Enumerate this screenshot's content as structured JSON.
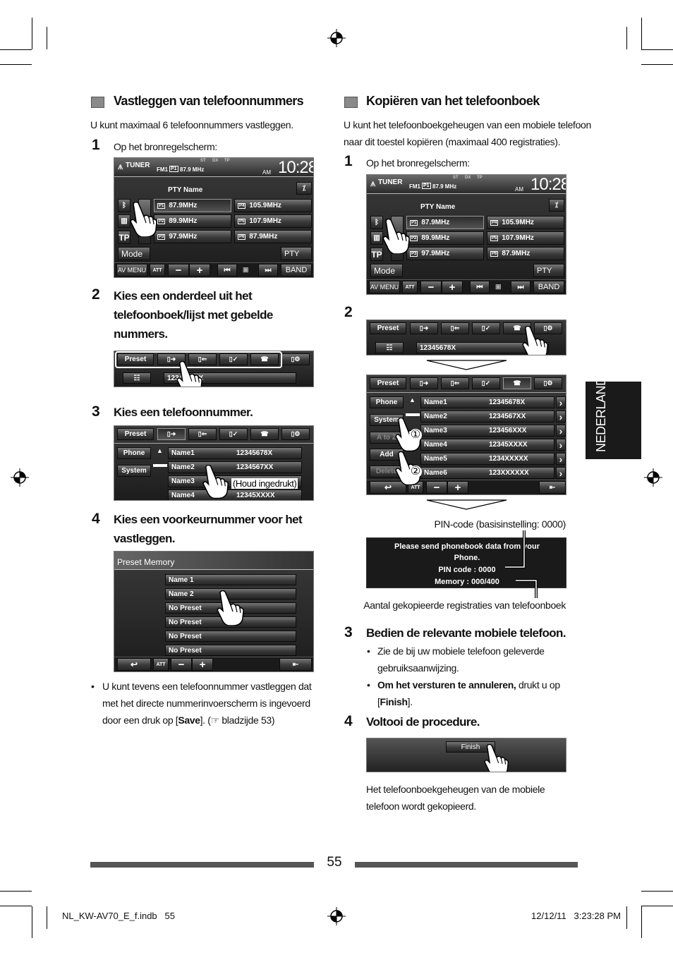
{
  "left": {
    "heading": "Vastleggen van telefoonnummers",
    "intro": "U kunt maximaal 6 telefoonnummers vastleggen.",
    "steps": [
      {
        "num": "1",
        "text": "Op het bronregelscherm:"
      },
      {
        "num": "2",
        "lines": [
          "Kies een onderdeel uit het",
          "telefoonboek/lijst met gebelde",
          "nummers."
        ]
      },
      {
        "num": "3",
        "text": "Kies een telefoonnummer."
      },
      {
        "num": "4",
        "lines": [
          "Kies een voorkeurnummer voor het",
          "vastleggen."
        ]
      }
    ],
    "note": {
      "bullet": "•",
      "line1": "U kunt tevens een telefoonnummer vastleggen dat",
      "line2": "met het directe nummerinvoerscherm is ingevoerd",
      "line3a": "door een druk op [",
      "save": "Save",
      "line3b": "]. (",
      "ref_icon": "☞",
      "line3c": " bladzijde 53)"
    },
    "hold_callout": "(Houd ingedrukt)"
  },
  "right": {
    "heading": "Kopiëren van het telefoonboek",
    "intro": [
      "U kunt het telefoonboekgeheugen van een mobiele telefoon",
      "naar dit toestel kopiëren (maximaal 400 registraties)."
    ],
    "steps": [
      {
        "num": "1",
        "text": "Op het bronregelscherm:"
      },
      {
        "num": "2"
      },
      {
        "num": "3",
        "text": "Bedien de relevante mobiele telefoon."
      },
      {
        "num": "4",
        "text": "Voltooi de procedure."
      }
    ],
    "bullets": [
      {
        "lines": [
          "Zie de bij uw mobiele telefoon geleverde",
          "gebruiksaanwijzing."
        ]
      },
      {
        "bold": "Om het versturen te annuleren,",
        "rest": " drukt u op",
        "l2a": "[",
        "finish": "Finish",
        "l2b": "]."
      }
    ],
    "pin_label": "PIN-code (basisinstelling: 0000)",
    "memory_label": "Aantal gekopieerde registraties van telefoonboek",
    "final": [
      "Het telefoonboekgeheugen van de mobiele",
      "telefoon wordt gekopieerd."
    ],
    "callouts": [
      "①",
      "②"
    ]
  },
  "screens": {
    "tuner": {
      "source": "TUNER",
      "band_info": "FM1",
      "preset_badge": "P1",
      "freq": "87.9 MHz",
      "indicators": [
        "ST",
        "DX",
        "TP"
      ],
      "ampm": "AM",
      "clock": "10:28",
      "pty_name": "PTY Name",
      "presets": [
        {
          "badge": "P1",
          "freq": "87.9MHz"
        },
        {
          "badge": "P2",
          "freq": "89.9MHz"
        },
        {
          "badge": "P3",
          "freq": "97.9MHz"
        },
        {
          "badge": "P4",
          "freq": "105.9MHz"
        },
        {
          "badge": "P5",
          "freq": "107.9MHz"
        },
        {
          "badge": "P6",
          "freq": "87.9MHz"
        }
      ],
      "tp": "TP",
      "mode": "Mode",
      "pty": "PTY",
      "av_menu": "AV MENU",
      "att": "ATT",
      "minus": "−",
      "plus": "+",
      "prev": "⏮",
      "next": "⏭",
      "band": "BAND"
    },
    "phone_tabs": {
      "preset": "Preset",
      "number": "12345678X"
    },
    "phonebook": {
      "side": [
        {
          "label": "Phone",
          "enabled": true
        },
        {
          "label": "System",
          "enabled": true
        },
        {
          "label": "A to Z",
          "enabled": false
        },
        {
          "label": "Add",
          "enabled": true
        },
        {
          "label": "Delete",
          "enabled": false
        }
      ],
      "entries": [
        {
          "name": "Name1",
          "number": "12345678X"
        },
        {
          "name": "Name2",
          "number": "1234567XX"
        },
        {
          "name": "Name3",
          "number": "123456XXX"
        },
        {
          "name": "Name4",
          "number": "12345XXXX"
        },
        {
          "name": "Name5",
          "number": "1234XXXXX"
        },
        {
          "name": "Name6",
          "number": "123XXXXXX"
        }
      ],
      "att": "ATT",
      "minus": "−",
      "plus": "+",
      "chevron": "›",
      "up": "▲"
    },
    "preset_memory": {
      "title": "Preset Memory",
      "items": [
        "Name 1",
        "Name 2",
        "No Preset",
        "No Preset",
        "No Preset",
        "No Preset"
      ],
      "att": "ATT",
      "minus": "−",
      "plus": "+"
    },
    "dialog": {
      "line1": "Please send phonebook data from your",
      "line2": "Phone.",
      "pin": "PIN code : 0000",
      "memory": "Memory : 000/400"
    },
    "finish": {
      "label": "Finish"
    }
  },
  "side_tab": "NEDERLANDS",
  "footer": {
    "page": "55",
    "file": "NL_KW-AV70_E_f.indb   55",
    "timestamp": "12/12/11   3:23:28 PM"
  }
}
